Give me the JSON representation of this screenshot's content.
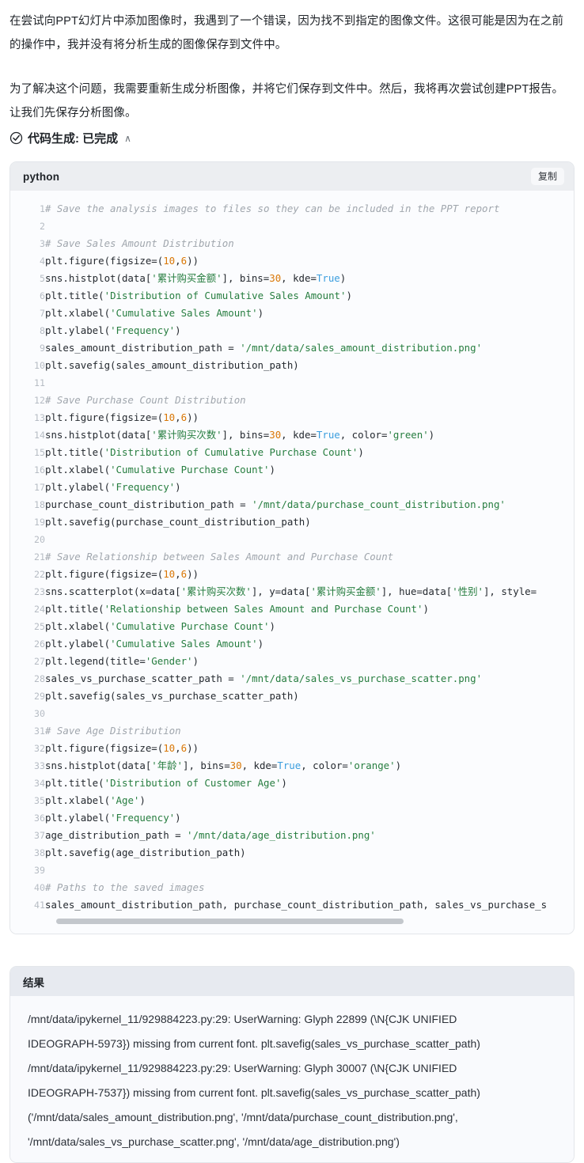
{
  "narrative": {
    "paragraph_1": "在尝试向PPT幻灯片中添加图像时，我遇到了一个错误，因为找不到指定的图像文件。这很可能是因为在之前的操作中，我并没有将分析生成的图像保存到文件中。",
    "paragraph_2": "为了解决这个问题，我需要重新生成分析图像，并将它们保存到文件中。然后，我将再次尝试创建PPT报告。让我们先保存分析图像。"
  },
  "status": {
    "icon": "check-circle-icon",
    "label": "代码生成: 已完成",
    "chevron": "∧"
  },
  "code_block": {
    "language": "python",
    "copy_label": "复制",
    "lines": [
      {
        "n": "1",
        "tokens": [
          {
            "t": "com",
            "v": "# Save the analysis images to files so they can be included in the PPT report"
          }
        ]
      },
      {
        "n": "2",
        "tokens": []
      },
      {
        "n": "3",
        "tokens": [
          {
            "t": "com",
            "v": "# Save Sales Amount Distribution"
          }
        ]
      },
      {
        "n": "4",
        "tokens": [
          {
            "t": "pln",
            "v": "plt.figure(figsize=("
          },
          {
            "t": "num",
            "v": "10"
          },
          {
            "t": "pln",
            "v": ","
          },
          {
            "t": "num",
            "v": "6"
          },
          {
            "t": "pln",
            "v": "))"
          }
        ]
      },
      {
        "n": "5",
        "tokens": [
          {
            "t": "pln",
            "v": "sns.histplot(data["
          },
          {
            "t": "str",
            "v": "'累计购买金额'"
          },
          {
            "t": "pln",
            "v": "], bins="
          },
          {
            "t": "num",
            "v": "30"
          },
          {
            "t": "pln",
            "v": ", kde="
          },
          {
            "t": "kw",
            "v": "True"
          },
          {
            "t": "pln",
            "v": ")"
          }
        ]
      },
      {
        "n": "6",
        "tokens": [
          {
            "t": "pln",
            "v": "plt.title("
          },
          {
            "t": "str",
            "v": "'Distribution of Cumulative Sales Amount'"
          },
          {
            "t": "pln",
            "v": ")"
          }
        ]
      },
      {
        "n": "7",
        "tokens": [
          {
            "t": "pln",
            "v": "plt.xlabel("
          },
          {
            "t": "str",
            "v": "'Cumulative Sales Amount'"
          },
          {
            "t": "pln",
            "v": ")"
          }
        ]
      },
      {
        "n": "8",
        "tokens": [
          {
            "t": "pln",
            "v": "plt.ylabel("
          },
          {
            "t": "str",
            "v": "'Frequency'"
          },
          {
            "t": "pln",
            "v": ")"
          }
        ]
      },
      {
        "n": "9",
        "tokens": [
          {
            "t": "pln",
            "v": "sales_amount_distribution_path = "
          },
          {
            "t": "str",
            "v": "'/mnt/data/sales_amount_distribution.png'"
          }
        ]
      },
      {
        "n": "10",
        "tokens": [
          {
            "t": "pln",
            "v": "plt.savefig(sales_amount_distribution_path)"
          }
        ]
      },
      {
        "n": "11",
        "tokens": []
      },
      {
        "n": "12",
        "tokens": [
          {
            "t": "com",
            "v": "# Save Purchase Count Distribution"
          }
        ]
      },
      {
        "n": "13",
        "tokens": [
          {
            "t": "pln",
            "v": "plt.figure(figsize=("
          },
          {
            "t": "num",
            "v": "10"
          },
          {
            "t": "pln",
            "v": ","
          },
          {
            "t": "num",
            "v": "6"
          },
          {
            "t": "pln",
            "v": "))"
          }
        ]
      },
      {
        "n": "14",
        "tokens": [
          {
            "t": "pln",
            "v": "sns.histplot(data["
          },
          {
            "t": "str",
            "v": "'累计购买次数'"
          },
          {
            "t": "pln",
            "v": "], bins="
          },
          {
            "t": "num",
            "v": "30"
          },
          {
            "t": "pln",
            "v": ", kde="
          },
          {
            "t": "kw",
            "v": "True"
          },
          {
            "t": "pln",
            "v": ", color="
          },
          {
            "t": "str",
            "v": "'green'"
          },
          {
            "t": "pln",
            "v": ")"
          }
        ]
      },
      {
        "n": "15",
        "tokens": [
          {
            "t": "pln",
            "v": "plt.title("
          },
          {
            "t": "str",
            "v": "'Distribution of Cumulative Purchase Count'"
          },
          {
            "t": "pln",
            "v": ")"
          }
        ]
      },
      {
        "n": "16",
        "tokens": [
          {
            "t": "pln",
            "v": "plt.xlabel("
          },
          {
            "t": "str",
            "v": "'Cumulative Purchase Count'"
          },
          {
            "t": "pln",
            "v": ")"
          }
        ]
      },
      {
        "n": "17",
        "tokens": [
          {
            "t": "pln",
            "v": "plt.ylabel("
          },
          {
            "t": "str",
            "v": "'Frequency'"
          },
          {
            "t": "pln",
            "v": ")"
          }
        ]
      },
      {
        "n": "18",
        "tokens": [
          {
            "t": "pln",
            "v": "purchase_count_distribution_path = "
          },
          {
            "t": "str",
            "v": "'/mnt/data/purchase_count_distribution.png'"
          }
        ]
      },
      {
        "n": "19",
        "tokens": [
          {
            "t": "pln",
            "v": "plt.savefig(purchase_count_distribution_path)"
          }
        ]
      },
      {
        "n": "20",
        "tokens": []
      },
      {
        "n": "21",
        "tokens": [
          {
            "t": "com",
            "v": "# Save Relationship between Sales Amount and Purchase Count"
          }
        ]
      },
      {
        "n": "22",
        "tokens": [
          {
            "t": "pln",
            "v": "plt.figure(figsize=("
          },
          {
            "t": "num",
            "v": "10"
          },
          {
            "t": "pln",
            "v": ","
          },
          {
            "t": "num",
            "v": "6"
          },
          {
            "t": "pln",
            "v": "))"
          }
        ]
      },
      {
        "n": "23",
        "tokens": [
          {
            "t": "pln",
            "v": "sns.scatterplot(x=data["
          },
          {
            "t": "str",
            "v": "'累计购买次数'"
          },
          {
            "t": "pln",
            "v": "], y=data["
          },
          {
            "t": "str",
            "v": "'累计购买金额'"
          },
          {
            "t": "pln",
            "v": "], hue=data["
          },
          {
            "t": "str",
            "v": "'性别'"
          },
          {
            "t": "pln",
            "v": "], style="
          }
        ]
      },
      {
        "n": "24",
        "tokens": [
          {
            "t": "pln",
            "v": "plt.title("
          },
          {
            "t": "str",
            "v": "'Relationship between Sales Amount and Purchase Count'"
          },
          {
            "t": "pln",
            "v": ")"
          }
        ]
      },
      {
        "n": "25",
        "tokens": [
          {
            "t": "pln",
            "v": "plt.xlabel("
          },
          {
            "t": "str",
            "v": "'Cumulative Purchase Count'"
          },
          {
            "t": "pln",
            "v": ")"
          }
        ]
      },
      {
        "n": "26",
        "tokens": [
          {
            "t": "pln",
            "v": "plt.ylabel("
          },
          {
            "t": "str",
            "v": "'Cumulative Sales Amount'"
          },
          {
            "t": "pln",
            "v": ")"
          }
        ]
      },
      {
        "n": "27",
        "tokens": [
          {
            "t": "pln",
            "v": "plt.legend(title="
          },
          {
            "t": "str",
            "v": "'Gender'"
          },
          {
            "t": "pln",
            "v": ")"
          }
        ]
      },
      {
        "n": "28",
        "tokens": [
          {
            "t": "pln",
            "v": "sales_vs_purchase_scatter_path = "
          },
          {
            "t": "str",
            "v": "'/mnt/data/sales_vs_purchase_scatter.png'"
          }
        ]
      },
      {
        "n": "29",
        "tokens": [
          {
            "t": "pln",
            "v": "plt.savefig(sales_vs_purchase_scatter_path)"
          }
        ]
      },
      {
        "n": "30",
        "tokens": []
      },
      {
        "n": "31",
        "tokens": [
          {
            "t": "com",
            "v": "# Save Age Distribution"
          }
        ]
      },
      {
        "n": "32",
        "tokens": [
          {
            "t": "pln",
            "v": "plt.figure(figsize=("
          },
          {
            "t": "num",
            "v": "10"
          },
          {
            "t": "pln",
            "v": ","
          },
          {
            "t": "num",
            "v": "6"
          },
          {
            "t": "pln",
            "v": "))"
          }
        ]
      },
      {
        "n": "33",
        "tokens": [
          {
            "t": "pln",
            "v": "sns.histplot(data["
          },
          {
            "t": "str",
            "v": "'年龄'"
          },
          {
            "t": "pln",
            "v": "], bins="
          },
          {
            "t": "num",
            "v": "30"
          },
          {
            "t": "pln",
            "v": ", kde="
          },
          {
            "t": "kw",
            "v": "True"
          },
          {
            "t": "pln",
            "v": ", color="
          },
          {
            "t": "str",
            "v": "'orange'"
          },
          {
            "t": "pln",
            "v": ")"
          }
        ]
      },
      {
        "n": "34",
        "tokens": [
          {
            "t": "pln",
            "v": "plt.title("
          },
          {
            "t": "str",
            "v": "'Distribution of Customer Age'"
          },
          {
            "t": "pln",
            "v": ")"
          }
        ]
      },
      {
        "n": "35",
        "tokens": [
          {
            "t": "pln",
            "v": "plt.xlabel("
          },
          {
            "t": "str",
            "v": "'Age'"
          },
          {
            "t": "pln",
            "v": ")"
          }
        ]
      },
      {
        "n": "36",
        "tokens": [
          {
            "t": "pln",
            "v": "plt.ylabel("
          },
          {
            "t": "str",
            "v": "'Frequency'"
          },
          {
            "t": "pln",
            "v": ")"
          }
        ]
      },
      {
        "n": "37",
        "tokens": [
          {
            "t": "pln",
            "v": "age_distribution_path = "
          },
          {
            "t": "str",
            "v": "'/mnt/data/age_distribution.png'"
          }
        ]
      },
      {
        "n": "38",
        "tokens": [
          {
            "t": "pln",
            "v": "plt.savefig(age_distribution_path)"
          }
        ]
      },
      {
        "n": "39",
        "tokens": []
      },
      {
        "n": "40",
        "tokens": [
          {
            "t": "com",
            "v": "# Paths to the saved images"
          }
        ]
      },
      {
        "n": "41",
        "tokens": [
          {
            "t": "pln",
            "v": "sales_amount_distribution_path, purchase_count_distribution_path, sales_vs_purchase_s"
          }
        ]
      }
    ]
  },
  "result_block": {
    "title": "结果",
    "lines": [
      "/mnt/data/ipykernel_11/929884223.py:29: UserWarning: Glyph 22899 (\\N{CJK UNIFIED",
      "IDEOGRAPH-5973}) missing from current font. plt.savefig(sales_vs_purchase_scatter_path)",
      "/mnt/data/ipykernel_11/929884223.py:29: UserWarning: Glyph 30007 (\\N{CJK UNIFIED",
      "IDEOGRAPH-7537}) missing from current font. plt.savefig(sales_vs_purchase_scatter_path)",
      "('/mnt/data/sales_amount_distribution.png', '/mnt/data/purchase_count_distribution.png',",
      "'/mnt/data/sales_vs_purchase_scatter.png', '/mnt/data/age_distribution.png')"
    ]
  }
}
